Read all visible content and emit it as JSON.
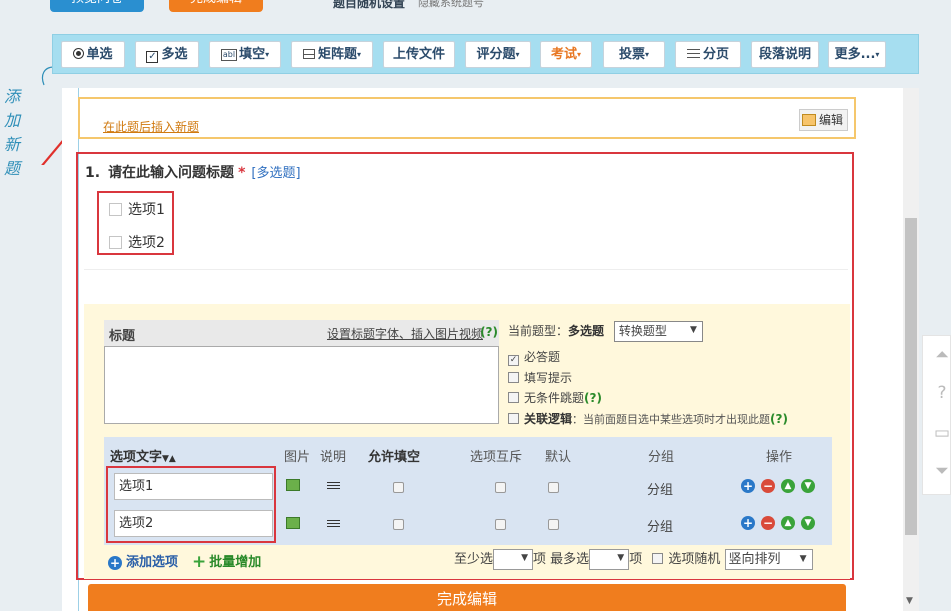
{
  "top": {
    "preview_label": "预览问卷",
    "finish_label": "完成编辑",
    "random_label": "题目随机设置",
    "hide_label": "隐藏系统题号"
  },
  "side_hint": [
    "添",
    "加",
    "新",
    "题"
  ],
  "toolbar": [
    {
      "key": "single",
      "label": "单选",
      "icon": "radio-icon",
      "dropdown": false
    },
    {
      "key": "multi",
      "label": "多选",
      "icon": "checkbox-icon",
      "dropdown": false
    },
    {
      "key": "fill",
      "label": "填空",
      "icon": "textbox-icon",
      "dropdown": true
    },
    {
      "key": "matrix",
      "label": "矩阵题",
      "icon": "matrix-icon",
      "dropdown": true
    },
    {
      "key": "upload",
      "label": "上传文件",
      "icon": "",
      "dropdown": false
    },
    {
      "key": "rating",
      "label": "评分题",
      "icon": "",
      "dropdown": true
    },
    {
      "key": "exam",
      "label": "考试",
      "icon": "",
      "dropdown": true
    },
    {
      "key": "vote",
      "label": "投票",
      "icon": "",
      "dropdown": true
    },
    {
      "key": "page",
      "label": "分页",
      "icon": "page-break-icon",
      "dropdown": false
    },
    {
      "key": "para",
      "label": "段落说明",
      "icon": "",
      "dropdown": false
    },
    {
      "key": "more",
      "label": "更多...",
      "icon": "",
      "dropdown": true
    }
  ],
  "insert": {
    "link_label": "在此题后插入新题",
    "edit_label": "编辑"
  },
  "question": {
    "number": "1.",
    "title": "请在此输入问题标题",
    "required_mark": "*",
    "type_tag": "[多选题]",
    "options": [
      "选项1",
      "选项2"
    ]
  },
  "editor": {
    "title_label": "标题",
    "title_settings": "设置标题字体、插入图片视频",
    "help": "(?)",
    "current_type_label": "当前题型：",
    "current_type": "多选题",
    "convert_label": "转换题型",
    "checks": {
      "required": "必答题",
      "hint": "填写提示",
      "skip": "无条件跳题",
      "logic": "关联逻辑",
      "logic_note": "：当前面题目选中某些选项时才出现此题"
    },
    "table": {
      "headers": [
        "选项文字",
        "图片",
        "说明",
        "允许填空",
        "选项互斥",
        "默认",
        "分组",
        "操作"
      ],
      "rows": [
        {
          "text": "选项1",
          "group": "分组"
        },
        {
          "text": "选项2",
          "group": "分组"
        }
      ]
    },
    "bottom": {
      "add_option": "添加选项",
      "batch_add": "批量增加",
      "min_label": "至少选",
      "item": "项",
      "max_label": "最多选",
      "random_opts": "选项随机",
      "direction": "竖向排列"
    },
    "finish_label": "完成编辑"
  },
  "colors": {
    "toolbar_bg": "#a6def0",
    "highlight_red": "#d9363e",
    "orange": "#f07d1e",
    "editor_bg": "#fff8dc",
    "table_bg": "#d9e4f2"
  }
}
